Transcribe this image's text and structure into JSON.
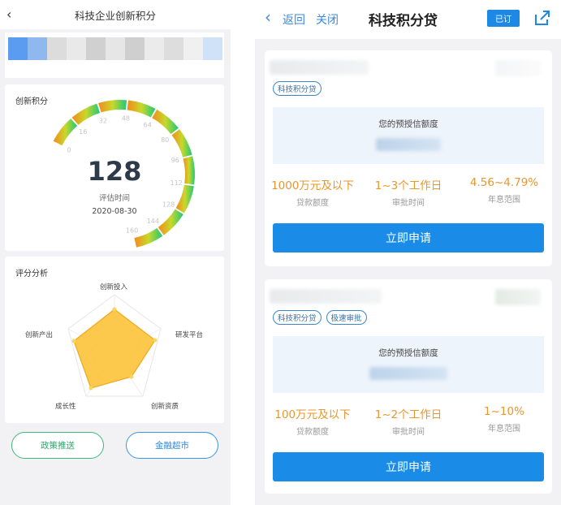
{
  "left": {
    "title": "科技企业创新积分",
    "gauge_card": {
      "title": "创新积分",
      "score": "128",
      "eval_label": "评估时间",
      "eval_date": "2020-08-30",
      "ticks": [
        "0",
        "16",
        "32",
        "48",
        "64",
        "80",
        "96",
        "112",
        "128",
        "144",
        "160"
      ]
    },
    "radar_card": {
      "title": "评分分析",
      "axes": [
        "创新投入",
        "研发平台",
        "创新资质",
        "成长性",
        "创新产出"
      ]
    },
    "buttons": {
      "policy": "政策推送",
      "finance": "金融超市"
    }
  },
  "right": {
    "header": {
      "back": "返回",
      "close": "关闭",
      "title": "科技积分贷",
      "subscribed": "已订"
    },
    "loans": [
      {
        "tags": [
          "科技积分贷"
        ],
        "pre_label": "您的预授信额度",
        "amount": "1000万元及以下",
        "amount_label": "贷款额度",
        "approval": "1~3个工作日",
        "approval_label": "审批时间",
        "rate": "4.56~4.79%",
        "rate_label": "年息范围",
        "apply": "立即申请"
      },
      {
        "tags": [
          "科技积分贷",
          "极速审批"
        ],
        "pre_label": "您的预授信额度",
        "amount": "100万元及以下",
        "amount_label": "贷款额度",
        "approval": "1~2个工作日",
        "approval_label": "审批时间",
        "rate": "1~10%",
        "rate_label": "年息范围",
        "apply": "立即申请"
      }
    ]
  },
  "colors": {
    "gauge_start": "#f28a1a",
    "gauge_mid": "#c9d82a",
    "gauge_end": "#1ec87a",
    "radar_fill": "#fbbf2e",
    "accent_blue": "#1a8ce8",
    "value_orange": "#e8962e"
  }
}
